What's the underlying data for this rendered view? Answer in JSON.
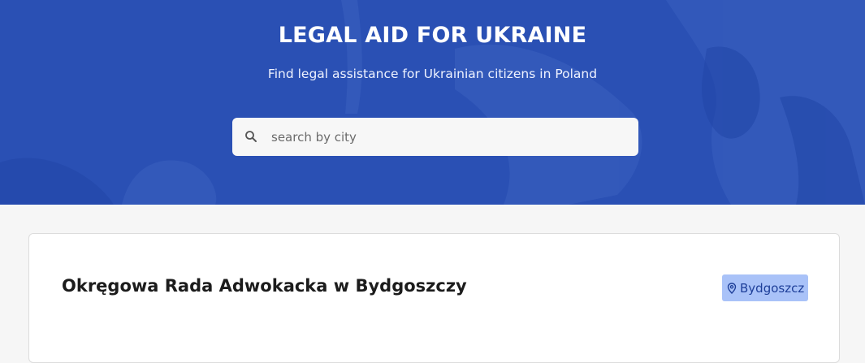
{
  "hero": {
    "title": "LEGAL AID FOR UKRAINE",
    "subtitle": "Find legal assistance for Ukrainian citizens in Poland",
    "background_color": "#2a50b4"
  },
  "search": {
    "placeholder": "search by city",
    "value": "",
    "icon": "search-icon"
  },
  "results": [
    {
      "name": "Okręgowa Rada Adwokacka w Bydgoszczy",
      "city": "Bydgoszcz",
      "city_icon": "map-pin-icon"
    }
  ],
  "colors": {
    "accent": "#2a50b4",
    "badge_bg": "#a9c2f8",
    "badge_text": "#1e3f99"
  }
}
